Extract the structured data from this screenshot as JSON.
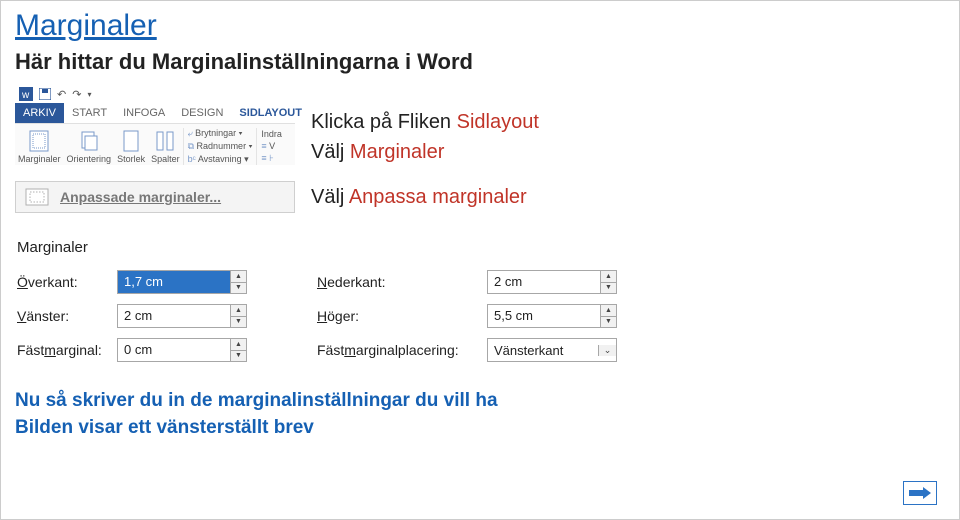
{
  "title": "Marginaler",
  "subtitle": "Här hittar du Marginalinställningarna i Word",
  "ribbon": {
    "tabs": {
      "file": "ARKIV",
      "start": "START",
      "infoga": "INFOGA",
      "design": "DESIGN",
      "sidlayout": "SIDLAYOUT"
    },
    "groups": {
      "marginaler": "Marginaler",
      "orientering": "Orientering",
      "storlek": "Storlek",
      "spalter": "Spalter",
      "brytningar": "Brytningar ▾",
      "radnummer": "Radnummer ▾",
      "avstavning": "Avstavning ▾",
      "indra": "Indra",
      "v": "V"
    }
  },
  "instruction1_prefix": "Klicka på Fliken ",
  "instruction1_hl": "Sidlayout",
  "instruction2_prefix": "Välj ",
  "instruction2_hl": "Marginaler",
  "menuitem_label": "Anpassade marginaler...",
  "instruction3_prefix": "Välj ",
  "instruction3_hl": "Anpassa marginaler",
  "panel": {
    "title": "Marginaler",
    "rows": [
      {
        "l1": "Överkant:",
        "v1": "1,7 cm",
        "l2": "Nederkant:",
        "v2": "2 cm"
      },
      {
        "l1": "Vänster:",
        "v1": "2 cm",
        "l2": "Höger:",
        "v2": "5,5 cm"
      },
      {
        "l1": "Fästmarginal:",
        "v1": "0 cm",
        "l2": "Fästmarginalplacering:",
        "v2": "Vänsterkant"
      }
    ]
  },
  "footer1": "Nu så skriver du in de marginalinställningar du vill ha",
  "footer2": "Bilden visar ett vänsterställt brev"
}
